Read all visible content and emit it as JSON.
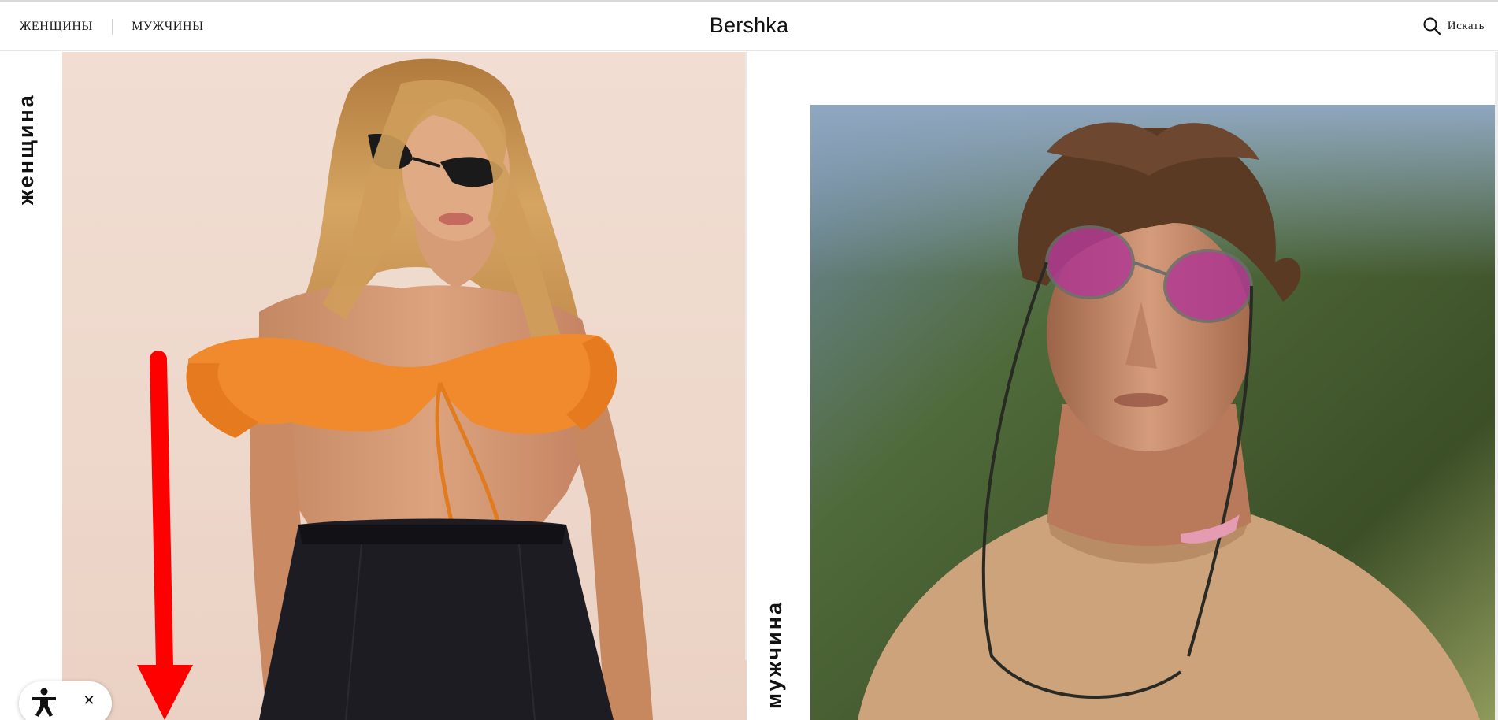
{
  "header": {
    "nav": [
      {
        "label": "ЖЕНЩИНЫ"
      },
      {
        "label": "МУЖЧИНЫ"
      }
    ],
    "logo": "Bershka",
    "search_label": "Искать"
  },
  "sections": {
    "women": {
      "label": "женщина"
    },
    "men": {
      "label": "мужчина"
    }
  },
  "colors": {
    "annotation_arrow": "#ff0000",
    "top_accent": "#f08a2c",
    "bottoms": "#1c1c22",
    "lens_tint": "#b13a93",
    "men_sweater": "#cda37c"
  },
  "icons": {
    "search": "search-icon",
    "accessibility": "accessibility-icon",
    "close": "close-icon",
    "annotation": "down-arrow-icon"
  }
}
